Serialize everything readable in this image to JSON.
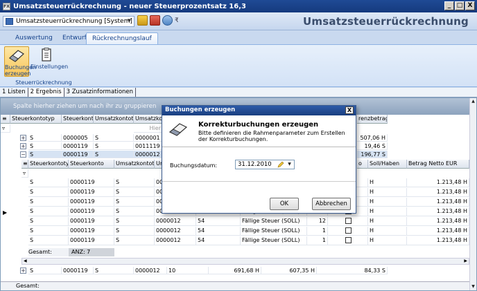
{
  "window": {
    "title": "Umsatzsteuerrückrechnung - neuer Steuerprozentsatz 16,3",
    "app_icon_text": "FX",
    "min_btn": "_",
    "max_btn": "□",
    "close_btn": "X"
  },
  "qat": {
    "document_selector": "Umsatzsteuerrückrechnung [System]",
    "customize": "₹"
  },
  "app_title": "Umsatzsteuerrückrechnung",
  "ribbon": {
    "tabs": [
      "Auswertung",
      "Entwurf",
      "Rückrechnungslauf"
    ],
    "active_tab": 2,
    "buttons": {
      "buchungen_erzeugen": "Buchungen erzeugen",
      "einstellungen": "Einstellungen"
    },
    "group_label": "Steuerrückrechnung"
  },
  "subtabs": [
    "1 Listen",
    "2 Ergebnis",
    "3 Zusatzinformationen"
  ],
  "grid": {
    "group_panel_text": "Spalte hierher ziehen um nach ihr zu gruppieren",
    "filter_hint": "Hier",
    "outer_headers": [
      "Steuerkontotyp",
      "Steuerkonto",
      "Umsatzkontotyp",
      "Umsatzkont"
    ],
    "outer_header_right": "renzbetrag",
    "outer_rows": [
      {
        "typ": "S",
        "konto": "0000005",
        "ukt": "S",
        "uk": "0000001",
        "diff": "507,06 H"
      },
      {
        "typ": "S",
        "konto": "0000119",
        "ukt": "S",
        "uk": "0011119",
        "diff": "19,46 S"
      },
      {
        "typ": "S",
        "konto": "0000119",
        "ukt": "S",
        "uk": "0000012",
        "diff": "196,77 S"
      }
    ],
    "inner_headers": [
      "Steuerkontotyp",
      "Steuerkonto",
      "Umsatzkontotyp",
      "Ur"
    ],
    "inner_headers_right": [
      "o",
      "Soll/Haben",
      "Betrag Netto EUR"
    ],
    "inner_rows": [
      {
        "typ": "S",
        "konto": "0000119",
        "ukt": "S",
        "uk": "000",
        "n": "",
        "text": "",
        "qty": "",
        "sh": "H",
        "betrag": "1.213,48 H"
      },
      {
        "typ": "S",
        "konto": "0000119",
        "ukt": "S",
        "uk": "000",
        "n": "",
        "text": "",
        "qty": "",
        "sh": "H",
        "betrag": "1.213,48 H"
      },
      {
        "typ": "S",
        "konto": "0000119",
        "ukt": "S",
        "uk": "000",
        "n": "",
        "text": "",
        "qty": "",
        "sh": "H",
        "betrag": "1.213,48 H"
      },
      {
        "typ": "S",
        "konto": "0000119",
        "ukt": "S",
        "uk": "000",
        "n": "",
        "text": "Fällige Steuer (SOLL)",
        "qty": "",
        "sh": "H",
        "betrag": "1.213,48 H"
      },
      {
        "typ": "S",
        "konto": "0000119",
        "ukt": "S",
        "uk": "0000012",
        "n": "54",
        "text": "Fällige Steuer (SOLL)",
        "qty": "12",
        "sh": "H",
        "betrag": "1.213,48 H"
      },
      {
        "typ": "S",
        "konto": "0000119",
        "ukt": "S",
        "uk": "0000012",
        "n": "54",
        "text": "Fällige Steuer (SOLL)",
        "qty": "1",
        "sh": "H",
        "betrag": "1.213,48 H"
      },
      {
        "typ": "S",
        "konto": "0000119",
        "ukt": "S",
        "uk": "0000012",
        "n": "54",
        "text": "Fällige Steuer (SOLL)",
        "qty": "1",
        "sh": "H",
        "betrag": "1.213,48 H"
      }
    ],
    "inner_footer_label": "Gesamt:",
    "inner_footer_count": "ANZ: 7",
    "bottom_rows": [
      {
        "typ": "S",
        "konto": "0000119",
        "ukt": "S",
        "uk": "0000012",
        "n": "10",
        "a": "691,68 H",
        "b": "607,35 H",
        "c": "84,33 S"
      }
    ],
    "footer_label": "Gesamt:"
  },
  "dialog": {
    "title": "Buchungen erzeugen",
    "close": "X",
    "heading": "Korrekturbuchungen erzeugen",
    "description": "Bitte definieren die Rahmenparameter zum Erstellen der Korrekturbuchungen.",
    "date_label": "Buchungsdatum:",
    "date_value": "31.12.2010",
    "ok": "OK",
    "cancel": "Abbrechen"
  },
  "colors": {
    "titlebar": "#1f4a95",
    "ribbon_bg": "#d3e2f6",
    "accent_text": "#15428b",
    "selected_row": "#d6e3f3"
  }
}
